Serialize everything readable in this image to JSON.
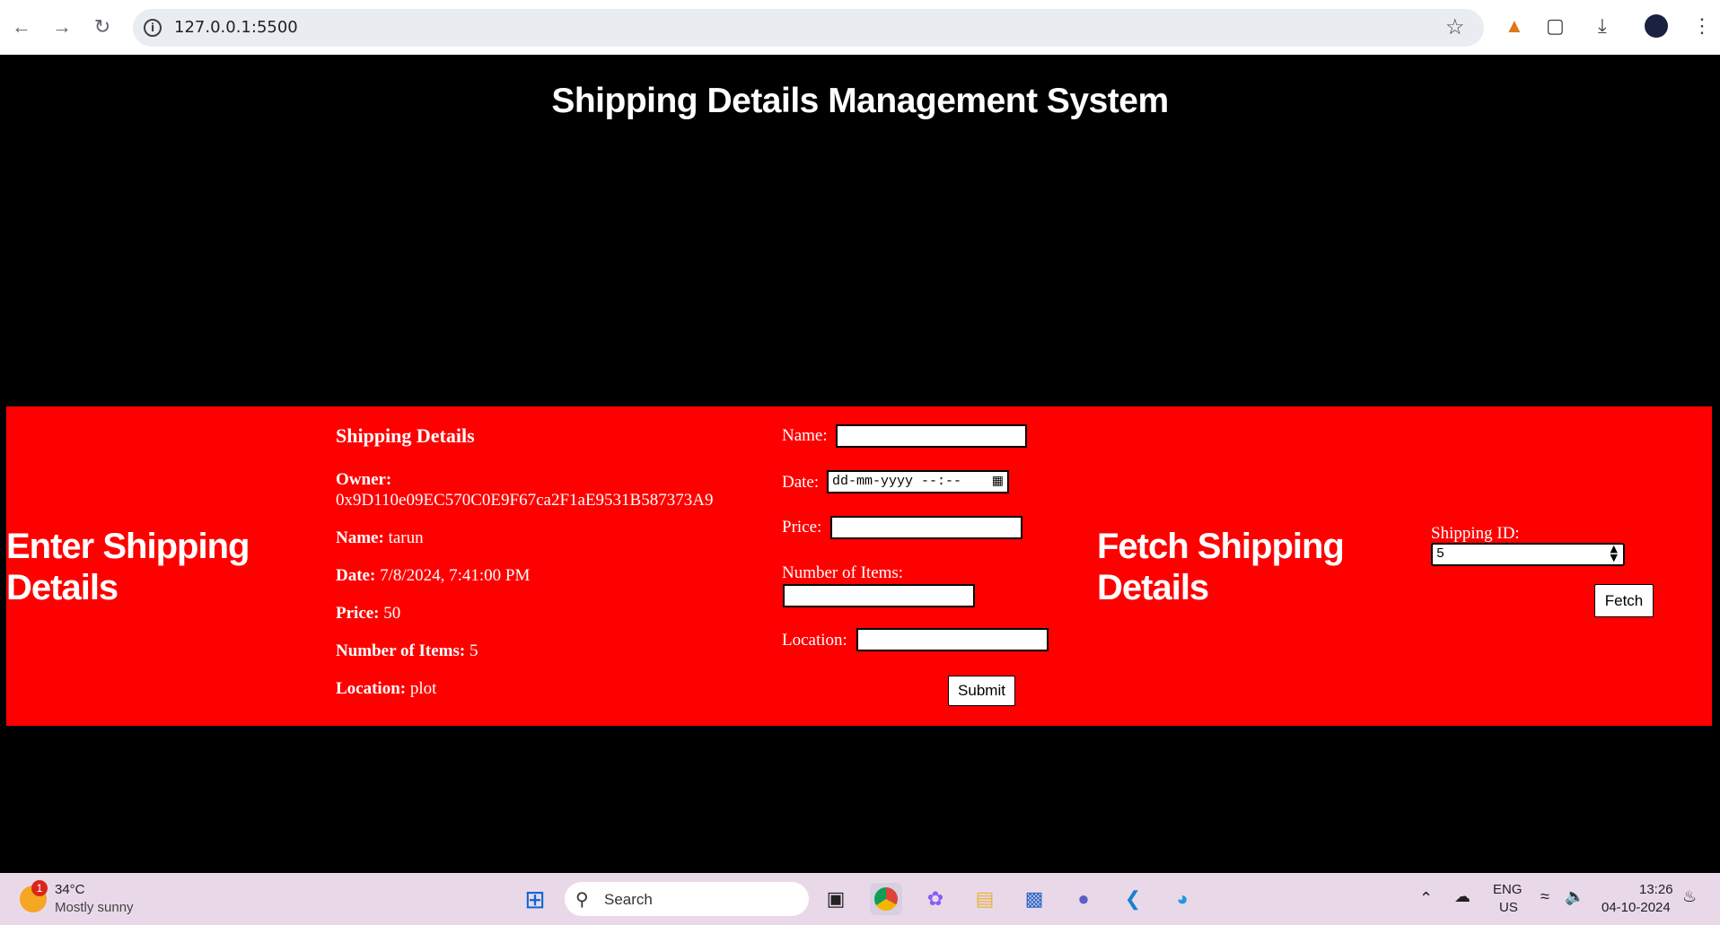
{
  "browser": {
    "url": "127.0.0.1:5500"
  },
  "page": {
    "title": "Shipping Details Management System",
    "enter_heading": "Enter Shipping Details",
    "fetch_heading": "Fetch Shipping Details"
  },
  "details": {
    "heading": "Shipping Details",
    "owner_label": "Owner:",
    "owner_value": "0x9D110e09EC570C0E9F67ca2F1aE9531B587373A9",
    "name_label": "Name:",
    "name_value": "tarun",
    "date_label": "Date:",
    "date_value": "7/8/2024, 7:41:00 PM",
    "price_label": "Price:",
    "price_value": "50",
    "items_label": "Number of Items:",
    "items_value": "5",
    "location_label": "Location:",
    "location_value": "plot"
  },
  "form": {
    "name_label": "Name:",
    "date_label": "Date:",
    "date_placeholder": "dd-mm-yyyy --:--",
    "price_label": "Price:",
    "items_label": "Number of Items:",
    "location_label": "Location:",
    "submit_label": "Submit"
  },
  "fetch": {
    "id_label": "Shipping ID:",
    "id_value": "5",
    "button_label": "Fetch"
  },
  "taskbar": {
    "weather_temp": "34°C",
    "weather_desc": "Mostly sunny",
    "weather_badge": "1",
    "search_label": "Search",
    "lang_line1": "ENG",
    "lang_line2": "US",
    "time": "13:26",
    "date": "04-10-2024"
  }
}
